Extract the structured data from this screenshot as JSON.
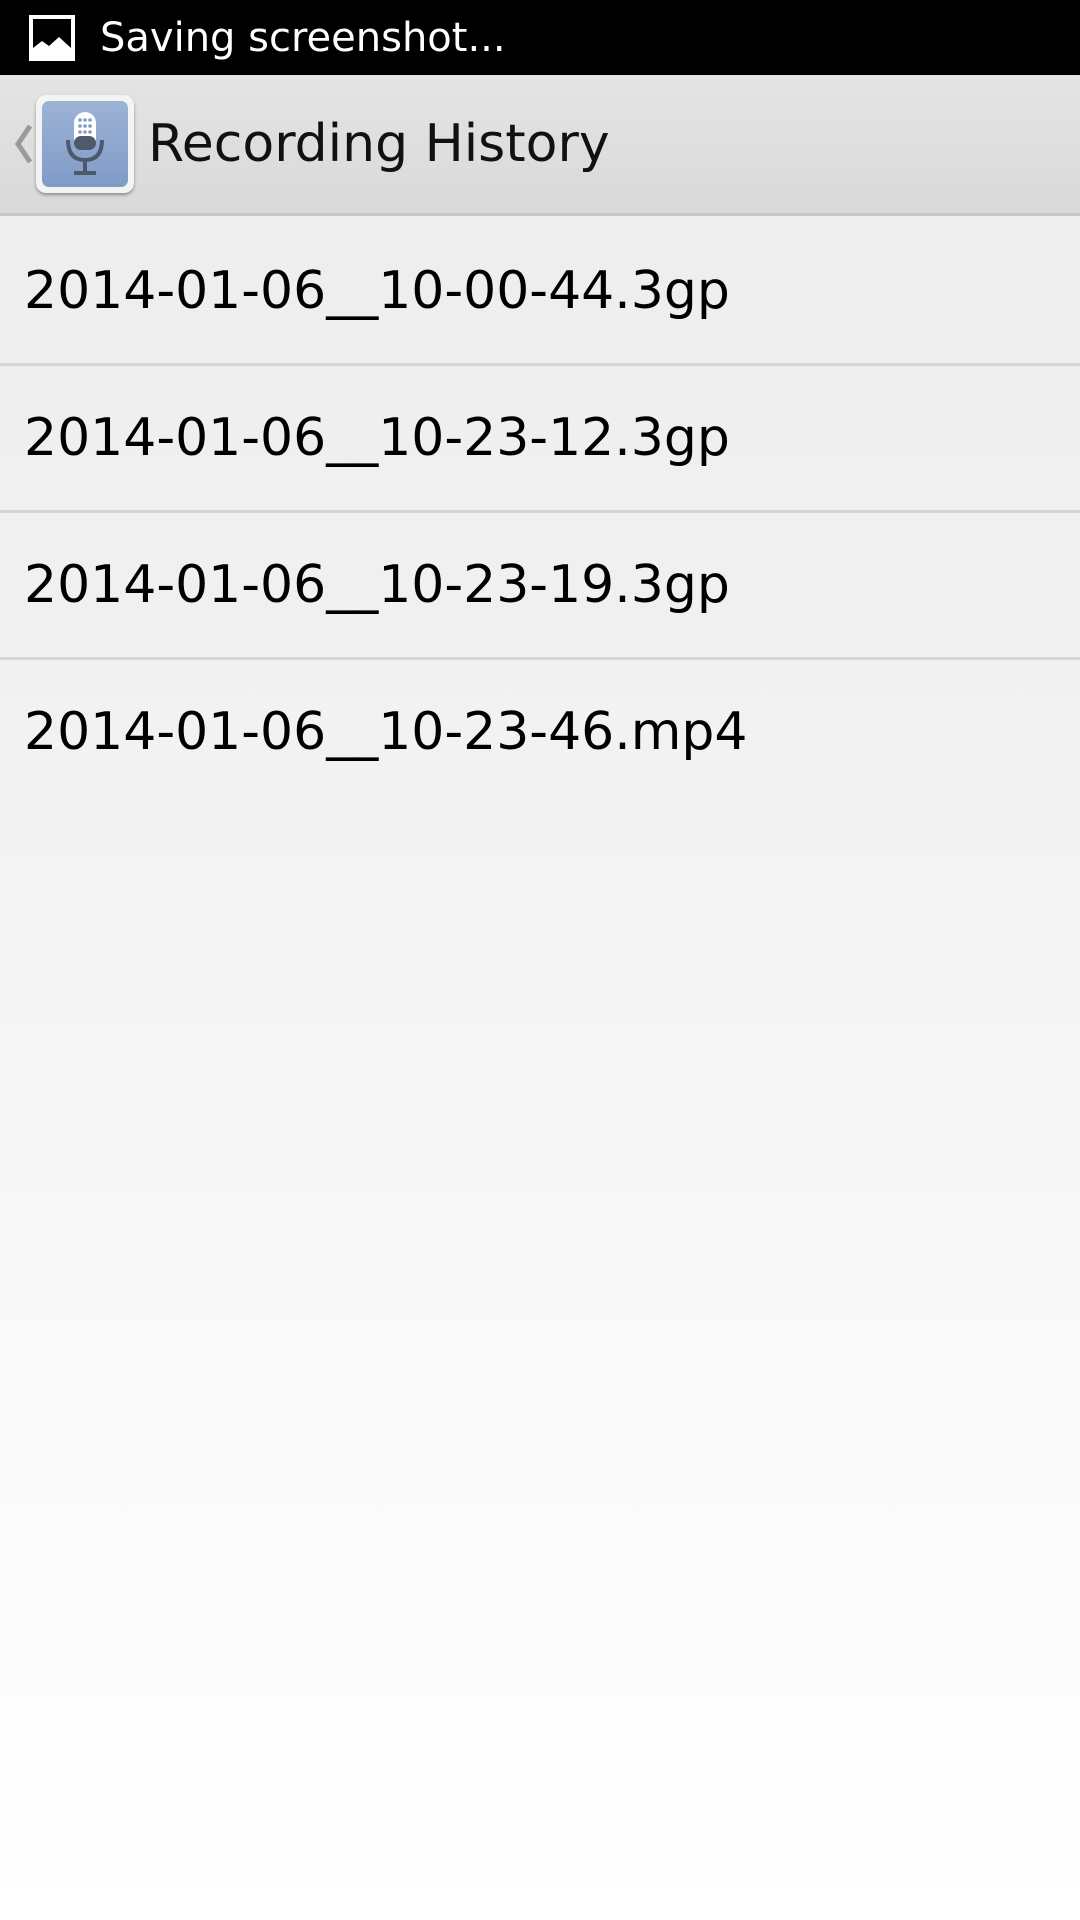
{
  "status_bar": {
    "notification_icon": "image-icon",
    "text": "Saving screenshot..."
  },
  "action_bar": {
    "up_icon": "chevron-left-icon",
    "app_icon": "microphone-icon",
    "title": "Recording History"
  },
  "recordings": [
    {
      "label": "2014-01-06__10-00-44.3gp"
    },
    {
      "label": "2014-01-06__10-23-12.3gp"
    },
    {
      "label": "2014-01-06__10-23-19.3gp"
    },
    {
      "label": "2014-01-06__10-23-46.mp4"
    }
  ],
  "colors": {
    "status_bar_bg": "#000000",
    "action_bar_bg": "#dcdcdc",
    "app_icon_accent": "#8aa5cf",
    "divider": "#d6d6d6"
  }
}
